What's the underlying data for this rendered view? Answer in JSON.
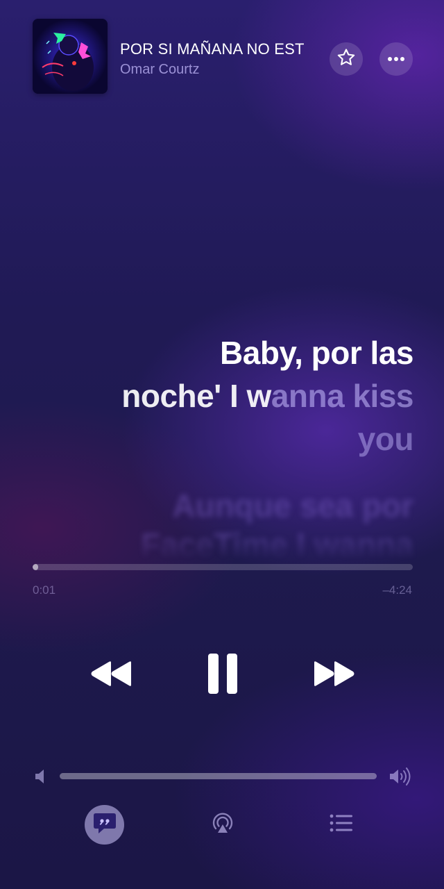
{
  "now_playing": {
    "title": "POR SI MAÑANA NO EST",
    "artist": "Omar Courtz",
    "artwork_icon": "album-artwork"
  },
  "header": {
    "favorite_icon": "star-icon",
    "more_icon": "ellipsis-icon"
  },
  "lyrics": {
    "current_line_1": "Baby, por las",
    "current_line_2_sung": "noche' I w",
    "current_line_2_unsung": "anna kiss",
    "current_line_3": "you",
    "next_line_1": "Aunque sea por",
    "next_line_2": "FaceTime I wanna"
  },
  "playback": {
    "elapsed": "0:01",
    "remaining": "–4:24",
    "progress_fraction": 0.004
  },
  "controls": {
    "rewind_icon": "rewind-icon",
    "pause_icon": "pause-icon",
    "forward_icon": "fast-forward-icon"
  },
  "volume": {
    "level_fraction": 1.0,
    "low_icon": "speaker-low-icon",
    "high_icon": "speaker-high-icon"
  },
  "bottom_bar": {
    "lyrics_icon": "lyrics-quote-icon",
    "airplay_icon": "airplay-audio-icon",
    "queue_icon": "queue-list-icon"
  },
  "colors": {
    "background_top": "#2a1f6e",
    "background_bottom": "#1b1646",
    "accent": "#8c6edc"
  }
}
